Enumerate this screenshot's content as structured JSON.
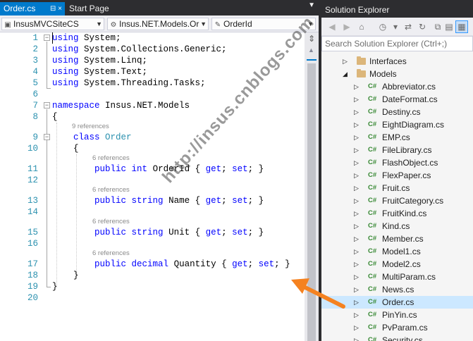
{
  "tabs": {
    "active": "Order.cs",
    "active_pin": "⊟ ×",
    "inactive": "Start Page",
    "overflow_icon": "chevron-down-icon"
  },
  "navbar": {
    "project": "InsusMVCSiteCS",
    "namespace": "Insus.NET.Models.Or",
    "member": "OrderId"
  },
  "editor": {
    "line_numbers": [
      "1",
      "2",
      "3",
      "4",
      "5",
      "6",
      "7",
      "8",
      "9",
      "10",
      "11",
      "12",
      "13",
      "14",
      "15",
      "16",
      "17",
      "18",
      "19",
      "20"
    ],
    "codelens": "9 references",
    "codelens_members": [
      "6 references",
      "6 references",
      "6 references",
      "6 references"
    ],
    "lines": {
      "l1": {
        "kw": "using",
        "rest": " System;"
      },
      "l2": {
        "kw": "using",
        "rest": " System.Collections.Generic;"
      },
      "l3": {
        "kw": "using",
        "rest": " System.Linq;"
      },
      "l4": {
        "kw": "using",
        "rest": " System.Text;"
      },
      "l5": {
        "kw": "using",
        "rest": " System.Threading.Tasks;"
      },
      "l7": {
        "kw": "namespace",
        "rest": " Insus.NET.Models"
      },
      "l8": {
        "text": "{"
      },
      "l9": {
        "kw": "class",
        "type": "Order"
      },
      "l10": {
        "text": "{"
      },
      "l11": {
        "kw1": "public",
        "kw2": "int",
        "name": " OrderId { ",
        "get": "get",
        "semi1": "; ",
        "set": "set",
        "end": "; }"
      },
      "l13": {
        "kw1": "public",
        "kw2": "string",
        "name": " Name { ",
        "get": "get",
        "semi1": "; ",
        "set": "set",
        "end": "; }"
      },
      "l15": {
        "kw1": "public",
        "kw2": "string",
        "name": " Unit { ",
        "get": "get",
        "semi1": "; ",
        "set": "set",
        "end": "; }"
      },
      "l17": {
        "kw1": "public",
        "kw2": "decimal",
        "name": " Quantity { ",
        "get": "get",
        "semi1": "; ",
        "set": "set",
        "end": "; }"
      },
      "l18": {
        "text": "}"
      },
      "l19": {
        "text": "}"
      }
    }
  },
  "solution_explorer": {
    "title": "Solution Explorer",
    "search_placeholder": "Search Solution Explorer (Ctrl+;)",
    "folders": [
      "Interfaces",
      "Models"
    ],
    "files": [
      "Abbreviator.cs",
      "DateFormat.cs",
      "Destiny.cs",
      "EightDiagram.cs",
      "EMP.cs",
      "FileLibrary.cs",
      "FlashObject.cs",
      "FlexPaper.cs",
      "Fruit.cs",
      "FruitCategory.cs",
      "FruitKind.cs",
      "Kind.cs",
      "Member.cs",
      "Model1.cs",
      "Model2.cs",
      "MultiParam.cs",
      "News.cs",
      "Order.cs",
      "PinYin.cs",
      "PvParam.cs",
      "Security.cs"
    ],
    "selected_file": "Order.cs",
    "file_icon_text": "C#"
  },
  "watermark": "http://insus.cnblogs.com",
  "colors": {
    "accent": "#007acc",
    "keyword": "#0000ff",
    "type": "#2b91af",
    "arrow": "#f58220",
    "selection": "#cce8ff"
  }
}
